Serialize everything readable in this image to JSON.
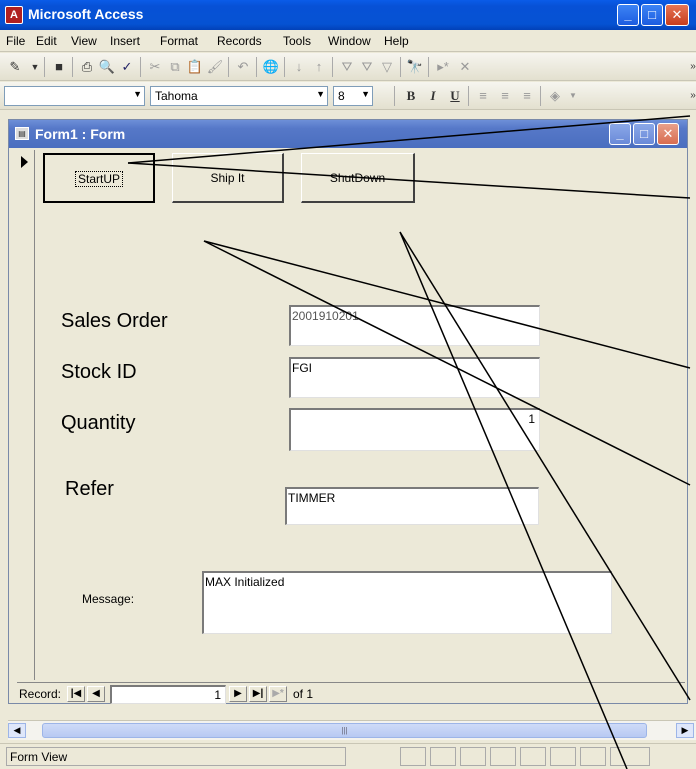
{
  "app": {
    "title": "Microsoft Access"
  },
  "menubar": {
    "items": [
      "File",
      "Edit",
      "View",
      "Insert",
      "Format",
      "Records",
      "Tools",
      "Window",
      "Help"
    ]
  },
  "toolbar2": {
    "font_name": "Tahoma",
    "font_size": "8",
    "bold_label": "B",
    "italic_label": "I",
    "underline_label": "U"
  },
  "form": {
    "title": "Form1 : Form",
    "buttons": {
      "startup": "StartUP",
      "ship": "Ship It",
      "shutdown": "ShutDown"
    },
    "fields": {
      "sales_order": {
        "label": "Sales Order",
        "value": "2001910201"
      },
      "stock_id": {
        "label": "Stock ID",
        "value": "FGI"
      },
      "quantity": {
        "label": "Quantity",
        "value": "1"
      },
      "refer": {
        "label": "Refer",
        "value": "TIMMER"
      },
      "message": {
        "label": "Message:",
        "value": "MAX Initialized"
      }
    },
    "navigation": {
      "record_label": "Record:",
      "current": "1",
      "of_text": "of 1"
    }
  },
  "statusbar": {
    "text": "Form View"
  }
}
